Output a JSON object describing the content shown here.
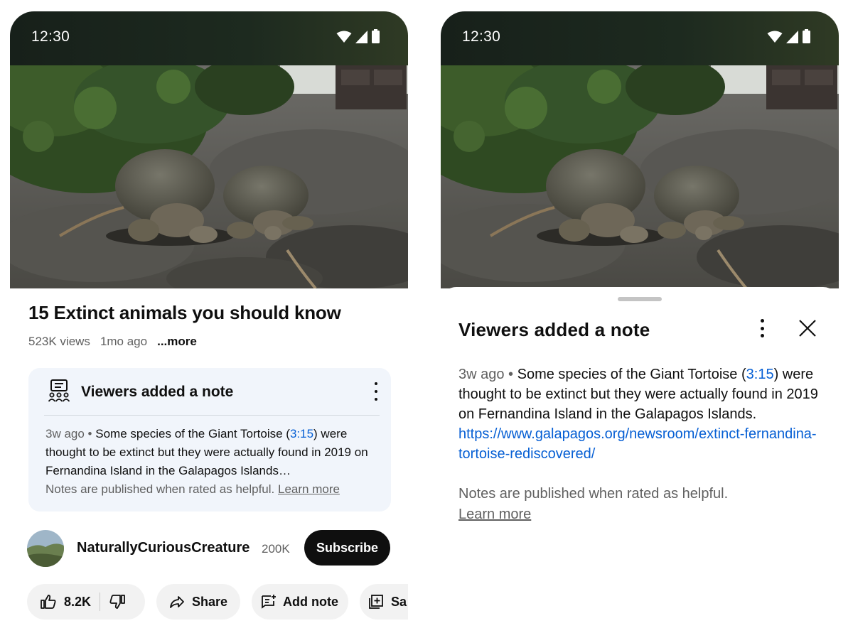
{
  "left": {
    "status": {
      "time": "12:30",
      "icons": [
        "wifi-icon",
        "signal-icon",
        "battery-icon"
      ]
    },
    "video": {
      "title": "15 Extinct animals you should know",
      "views": "523K views",
      "age": "1mo ago",
      "more": "...more"
    },
    "note": {
      "heading": "Viewers added a note",
      "age": "3w ago",
      "dot": " • ",
      "text_before": "Some species of the Giant Tortoise (",
      "timestamp": "3:15",
      "text_after": ") were thought to be extinct but they were actually found in 2019 on Fernandina Island in the Galapagos Islands…",
      "footer": "Notes are published when rated as helpful.",
      "learn_more": "Learn more"
    },
    "channel": {
      "name": "NaturallyCuriousCreature",
      "subscribers": "200K",
      "subscribe_label": "Subscribe"
    },
    "actions": {
      "likes": "8.2K",
      "share": "Share",
      "add_note": "Add note",
      "save": "Sa"
    }
  },
  "right": {
    "status": {
      "time": "12:30",
      "icons": [
        "wifi-icon",
        "signal-icon",
        "battery-icon"
      ]
    },
    "sheet": {
      "title": "Viewers added a note",
      "age": "3w ago",
      "dot": " • ",
      "text_before": "Some species of the Giant Tortoise (",
      "timestamp": "3:15",
      "text_after": ") were thought to be extinct but they were actually found in 2019 on Fernandina Island in the Galapagos Islands.",
      "url": "https://www.galapagos.org/newsroom/extinct-fernandina-tortoise-rediscovered/",
      "footer": "Notes are published when rated as helpful.",
      "learn_more": "Learn more"
    }
  },
  "colors": {
    "link": "#065fd4",
    "subscribe_bg": "#0f0f0f",
    "note_card_bg": "#f1f5fb",
    "muted_text": "#606060"
  }
}
